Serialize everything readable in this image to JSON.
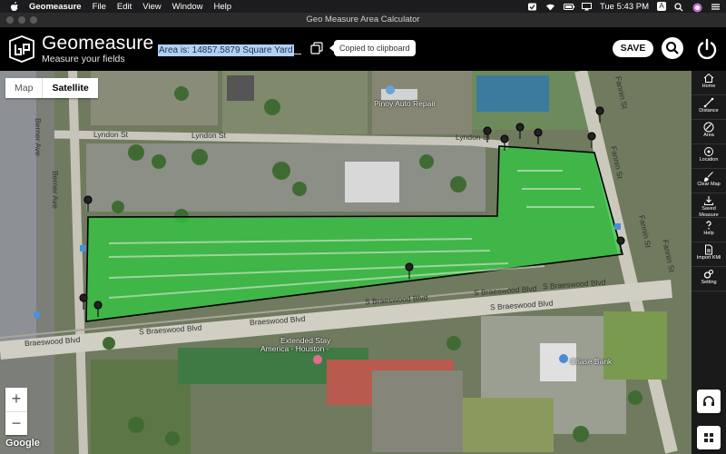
{
  "menubar": {
    "app_name": "Geomeasure",
    "menus": [
      "File",
      "Edit",
      "View",
      "Window",
      "Help"
    ],
    "clock": "Tue 5:43 PM",
    "input_source": "A"
  },
  "window": {
    "title": "Geo Measure Area Calculator"
  },
  "header": {
    "brand_name": "Geomeasure",
    "brand_tagline": "Measure your fields",
    "area_text": "Area is: 14857.5879 Square Yard",
    "toast": "Copied to clipboard",
    "save_label": "SAVE"
  },
  "map": {
    "type_options": [
      "Map",
      "Satellite"
    ],
    "selected_type": "Satellite",
    "zoom_in": "+",
    "zoom_out": "−",
    "attribution": "Google",
    "labels": {
      "lyndon_1": "Lyndon St",
      "lyndon_2": "Lyndon St",
      "lyndon_3": "Lyndon St",
      "berner_1": "Berner Ave",
      "berner_2": "Berner Ave",
      "fannin_1": "Fannin St",
      "fannin_2": "Fannin St",
      "fannin_3": "Fannin St",
      "fannin_4": "Fannin St",
      "braeswood_1": "S Braeswood Blvd",
      "braeswood_2": "S Braeswood Blvd",
      "braeswood_3": "S Braeswood Blvd",
      "braeswood_4": "S Braeswood Blvd",
      "braeswood_5": "Braeswood Blvd",
      "braeswood_6": "Braeswood Blvd",
      "braeswood_7": "S Braeswood Blvd",
      "pinoy": "Pinoy Auto Repair",
      "hotel_1": "Extended Stay",
      "hotel_2": "America - Houston -",
      "chase": "Chase Bank"
    },
    "polygon_color": "#2ecc40"
  },
  "toolbar": {
    "items": [
      {
        "label": "Home",
        "icon": "home-icon"
      },
      {
        "label": "Distance",
        "icon": "ruler-icon"
      },
      {
        "label": "Area",
        "icon": "area-icon"
      },
      {
        "label": "Location",
        "icon": "location-icon"
      },
      {
        "label": "Clear Map",
        "icon": "brush-icon"
      },
      {
        "label": "Saved Measure",
        "icon": "download-icon"
      },
      {
        "label": "Help",
        "icon": "question-icon"
      },
      {
        "label": "Import KMl",
        "icon": "file-icon"
      },
      {
        "label": "Setting",
        "icon": "gear-icon"
      }
    ]
  }
}
